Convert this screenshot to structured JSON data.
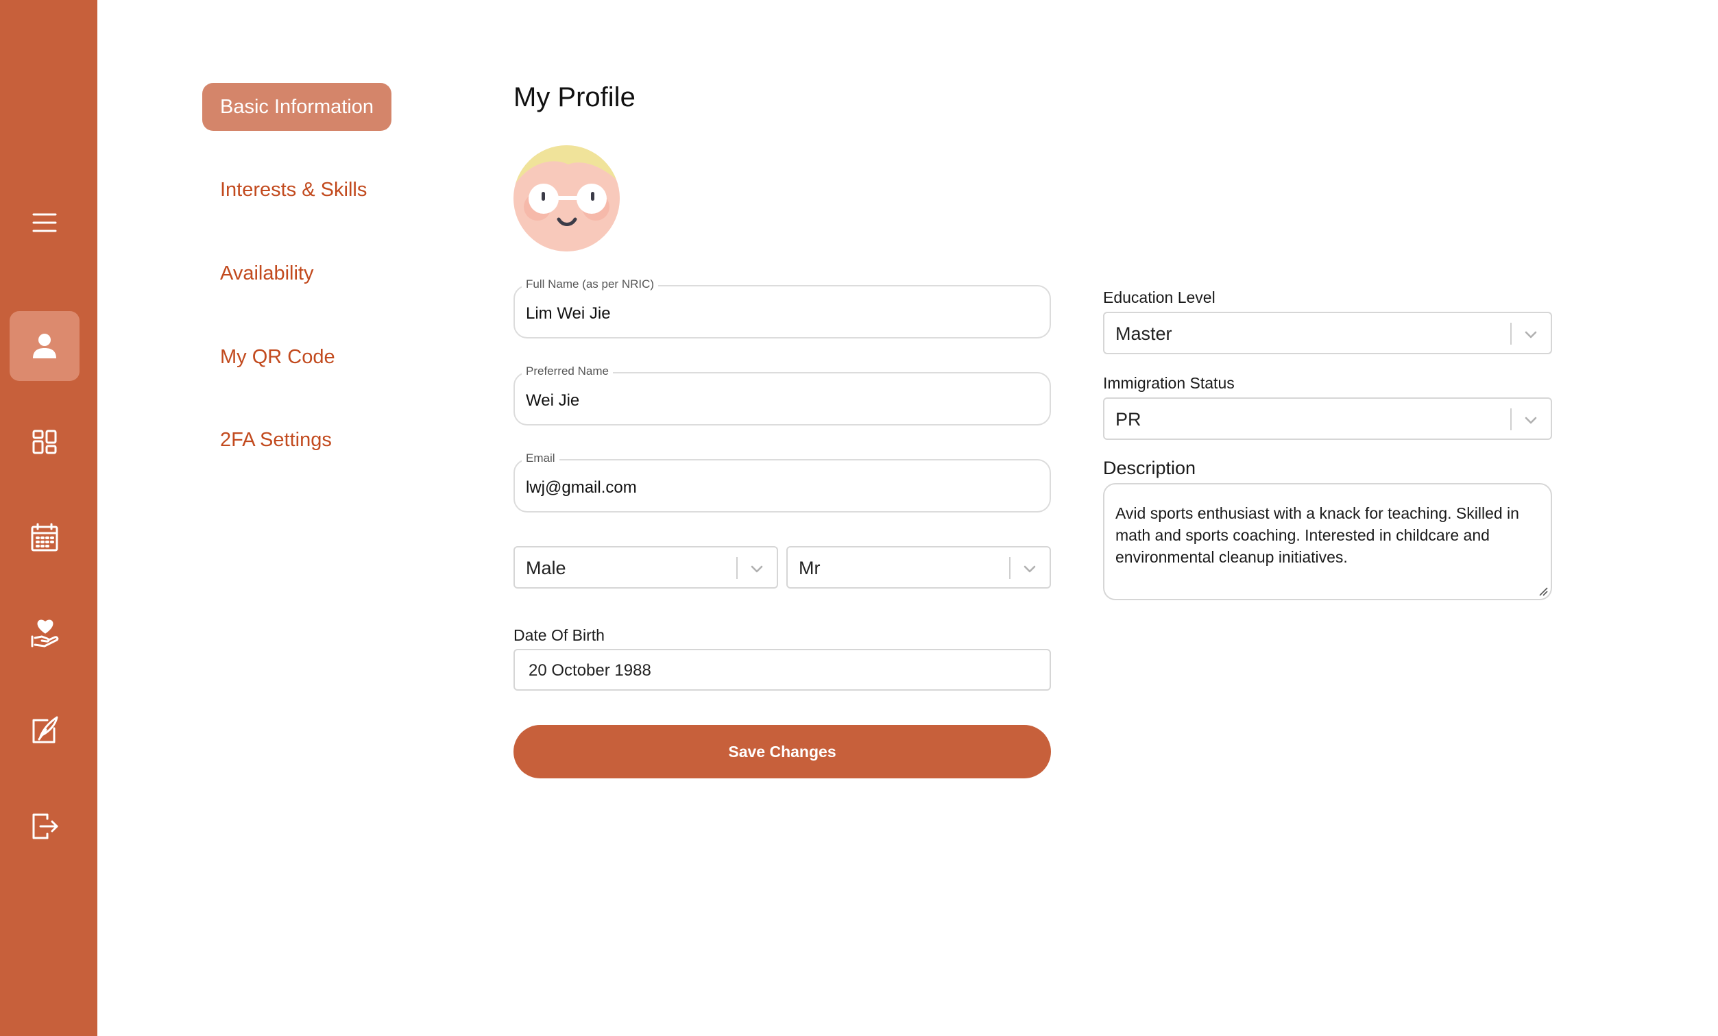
{
  "rail": {
    "items": [
      {
        "icon": "menu-icon"
      },
      {
        "icon": "user-icon",
        "active": true
      },
      {
        "icon": "dashboard-icon"
      },
      {
        "icon": "calendar-icon"
      },
      {
        "icon": "volunteer-heart-icon"
      },
      {
        "icon": "edit-icon"
      },
      {
        "icon": "logout-icon"
      }
    ]
  },
  "subnav": {
    "items": [
      {
        "label": "Basic Information",
        "active": true
      },
      {
        "label": "Interests & Skills"
      },
      {
        "label": "Availability"
      },
      {
        "label": "My QR Code"
      },
      {
        "label": "2FA Settings"
      }
    ]
  },
  "profile": {
    "title": "My Profile",
    "full_name": {
      "label": "Full Name (as per NRIC)",
      "value": "Lim Wei Jie"
    },
    "preferred_name": {
      "label": "Preferred Name",
      "value": "Wei Jie"
    },
    "email": {
      "label": "Email",
      "value": "lwj@gmail.com"
    },
    "gender": "Male",
    "salutation": "Mr",
    "dob": {
      "label": "Date Of Birth",
      "value": "20 October 1988"
    },
    "save_label": "Save Changes",
    "education": {
      "label": "Education Level",
      "value": "Master"
    },
    "immigration": {
      "label": "Immigration Status",
      "value": "PR"
    },
    "description": {
      "label": "Description",
      "value": "Avid sports enthusiast with a knack for teaching. Skilled in math and sports coaching. Interested in childcare and environmental cleanup initiatives."
    }
  },
  "colors": {
    "accent": "#c7603b",
    "accent_light": "#d4856a",
    "nav_text": "#c24a1e"
  }
}
